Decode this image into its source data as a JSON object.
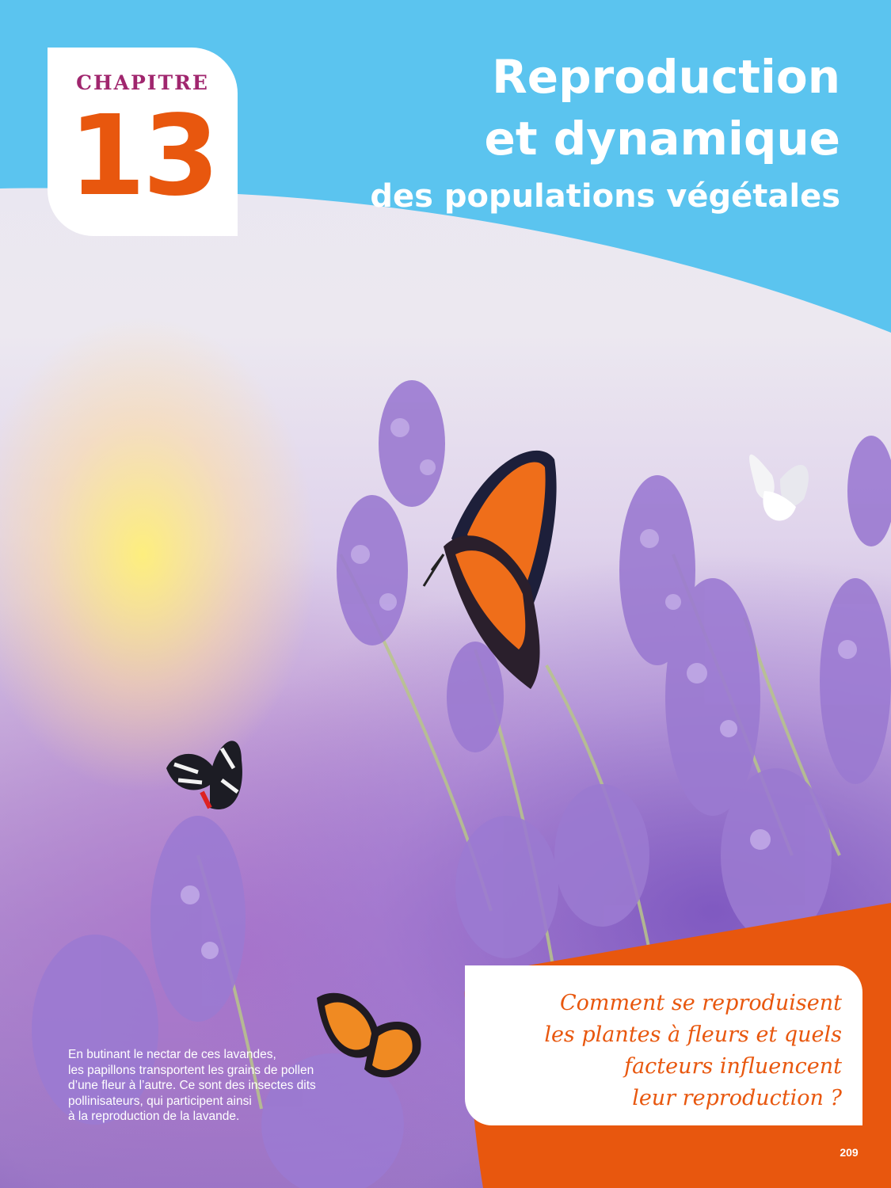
{
  "chapter": {
    "label": "CHAPITRE",
    "number": "13"
  },
  "title": {
    "line1": "Reproduction",
    "line2": "et dynamique",
    "line3": "des populations végétales"
  },
  "caption": {
    "lines": [
      "En butinant le nectar de ces lavandes,",
      "les papillons transportent les grains de pollen",
      "d’une fleur à l’autre. Ce sont des insectes dits",
      "pollinisateurs, qui participent ainsi",
      "à la reproduction de la lavande."
    ]
  },
  "question": {
    "lines": [
      "Comment se reproduisent",
      "les plantes à fleurs et quels",
      "facteurs influencent",
      "leur reproduction ?"
    ]
  },
  "page_number": "209",
  "colors": {
    "banner_blue": "#5bc4ef",
    "accent_orange": "#e8570e",
    "chapter_label": "#a0266e",
    "lavender": "#8c6cc0"
  }
}
